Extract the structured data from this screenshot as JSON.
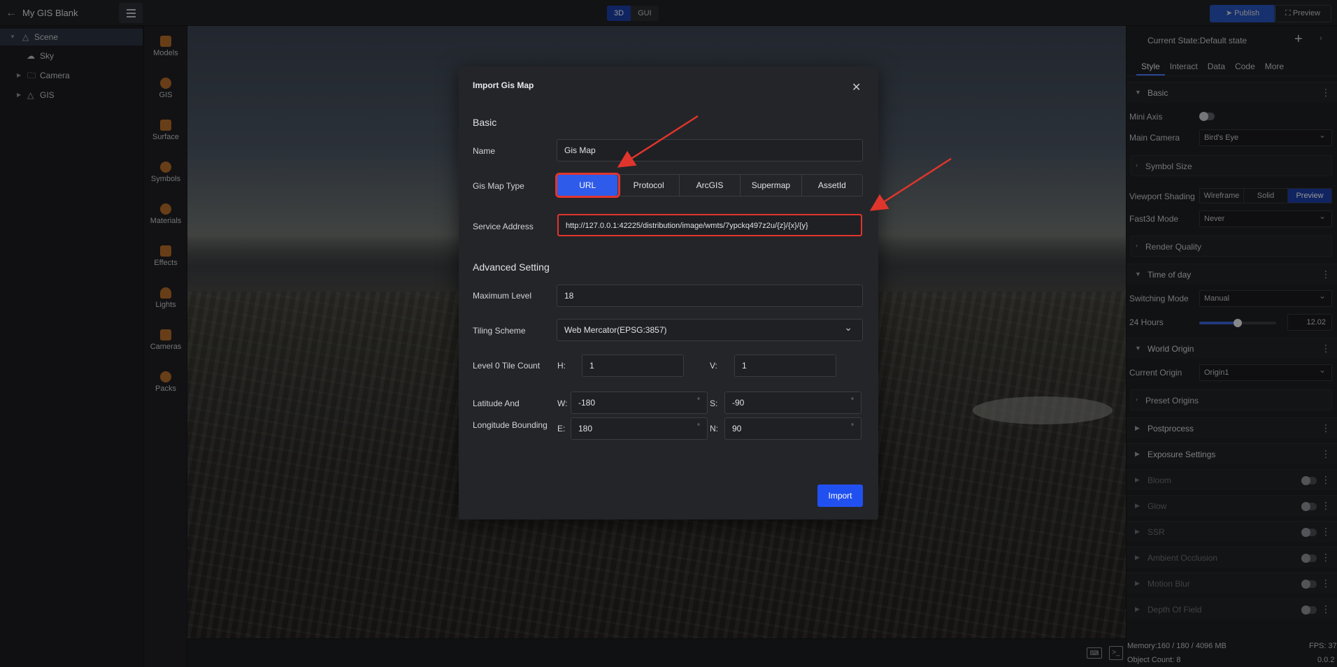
{
  "app": {
    "project_title": "My GIS Blank",
    "mode_tabs": [
      "3D",
      "GUI"
    ],
    "active_mode": "3D",
    "publish_label": "Publish",
    "preview_label": "Preview"
  },
  "scene_tree": {
    "items": [
      {
        "label": "Scene",
        "icon": "scene-icon",
        "selected": true
      },
      {
        "label": "Sky",
        "icon": "sky-icon"
      },
      {
        "label": "Camera",
        "icon": "folder-icon"
      },
      {
        "label": "GIS",
        "icon": "gis-icon"
      }
    ]
  },
  "resources": {
    "items": [
      {
        "label": "Models",
        "icon": "models-icon"
      },
      {
        "label": "GIS",
        "icon": "gis-icon"
      },
      {
        "label": "Surface",
        "icon": "surface-icon"
      },
      {
        "label": "Symbols",
        "icon": "symbols-icon"
      },
      {
        "label": "Materials",
        "icon": "materials-icon"
      },
      {
        "label": "Effects",
        "icon": "effects-icon"
      },
      {
        "label": "Lights",
        "icon": "lights-icon"
      },
      {
        "label": "Cameras",
        "icon": "cameras-icon"
      },
      {
        "label": "Packs",
        "icon": "packs-icon"
      }
    ]
  },
  "modal": {
    "title": "Import Gis Map",
    "basic_heading": "Basic",
    "name_label": "Name",
    "name_value": "Gis Map",
    "type_label": "Gis Map Type",
    "types": [
      "URL",
      "Protocol",
      "ArcGIS",
      "Supermap",
      "AssetId"
    ],
    "active_type": "URL",
    "service_label": "Service Address",
    "service_value": "http://127.0.0.1:42225/distribution/image/wmts/7ypckq497z2u/{z}/{x}/{y}",
    "advanced_heading": "Advanced Setting",
    "max_level_label": "Maximum Level",
    "max_level_value": "18",
    "tiling_label": "Tiling Scheme",
    "tiling_value": "Web Mercator(EPSG:3857)",
    "tile_count_label": "Level 0 Tile Count",
    "h_label": "H:",
    "h_value": "1",
    "v_label": "V:",
    "v_value": "1",
    "bounding_label_1": "Latitude And",
    "bounding_label_2": "Longitude Bounding",
    "w_label": "W:",
    "w_value": "-180",
    "s_label": "S:",
    "s_value": "-90",
    "e_label": "E:",
    "e_value": "180",
    "n_label": "N:",
    "n_value": "90",
    "degree_symbol": "°",
    "import_label": "Import"
  },
  "right_panel": {
    "state_label": "Current State:Default state",
    "tabs": [
      "Style",
      "Interact",
      "Data",
      "Code",
      "More"
    ],
    "active_tab": "Style",
    "basic": {
      "title": "Basic",
      "mini_axis_label": "Mini Axis",
      "main_camera_label": "Main Camera",
      "main_camera_value": "Bird's Eye",
      "symbol_size_label": "Symbol Size",
      "viewport_shading_label": "Viewport Shading",
      "shading_options": [
        "Wireframe",
        "Solid",
        "Preview"
      ],
      "shading_active": "Preview",
      "fast3d_label": "Fast3d Mode",
      "fast3d_value": "Never",
      "render_quality_label": "Render Quality"
    },
    "time_of_day": {
      "title": "Time of day",
      "switching_label": "Switching Mode",
      "switching_value": "Manual",
      "hours_label": "24 Hours",
      "hours_value": "12.02",
      "hours_fraction": 0.5
    },
    "world_origin": {
      "title": "World Origin",
      "current_label": "Current Origin",
      "current_value": "Origin1",
      "preset_label": "Preset Origins"
    },
    "postprocess_title": "Postprocess",
    "exposure_title": "Exposure Settings",
    "effects": [
      "Bloom",
      "Glow",
      "SSR",
      "Ambient Occlusion",
      "Motion Blur",
      "Depth Of Field"
    ]
  },
  "status": {
    "memory": "Memory:160 / 180 / 4096 MB",
    "object_count": "Object Count: 8",
    "fps": "FPS: 37",
    "version": "0.0.2"
  },
  "colors": {
    "accent": "#2150f0",
    "highlight": "#e0352c",
    "panel": "#1e1f22"
  }
}
